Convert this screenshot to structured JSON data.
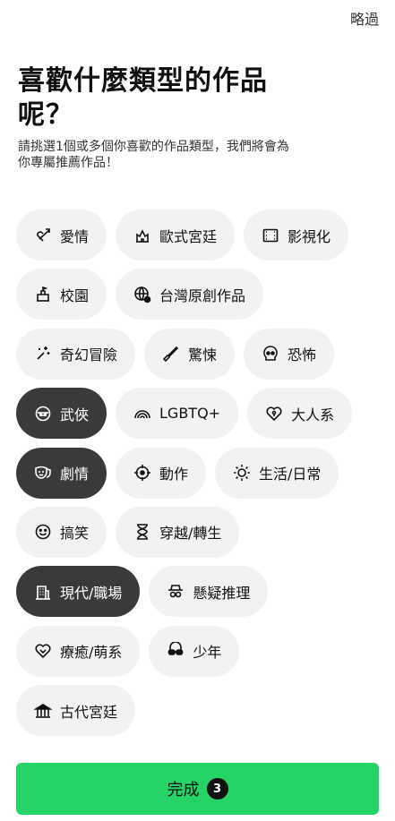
{
  "header": {
    "skip_label": "略過"
  },
  "title": "喜歡什麼類型的作品呢？",
  "description": "請挑選1個或多個你喜歡的作品類型，我們將會為你專屬推薦作品！",
  "genres": [
    {
      "label": "愛情",
      "icon": "cupid-arrow-icon",
      "selected": false
    },
    {
      "label": "歐式宮廷",
      "icon": "castle-icon",
      "selected": false
    },
    {
      "label": "影視化",
      "icon": "film-icon",
      "selected": false
    },
    {
      "label": "校園",
      "icon": "school-icon",
      "selected": false
    },
    {
      "label": "台灣原創作品",
      "icon": "globe-icon",
      "selected": false
    },
    {
      "label": "奇幻冒險",
      "icon": "magic-sparkle-icon",
      "selected": false
    },
    {
      "label": "驚悚",
      "icon": "knife-icon",
      "selected": false
    },
    {
      "label": "恐怖",
      "icon": "skull-icon",
      "selected": false
    },
    {
      "label": "武俠",
      "icon": "ninja-mask-icon",
      "selected": true
    },
    {
      "label": "LGBTQ+",
      "icon": "rainbow-icon",
      "selected": false
    },
    {
      "label": "大人系",
      "icon": "heart-lock-icon",
      "selected": false
    },
    {
      "label": "劇情",
      "icon": "theater-mask-icon",
      "selected": true
    },
    {
      "label": "動作",
      "icon": "crosshair-icon",
      "selected": false
    },
    {
      "label": "生活/日常",
      "icon": "sun-icon",
      "selected": false
    },
    {
      "label": "搞笑",
      "icon": "smile-icon",
      "selected": false
    },
    {
      "label": "穿越/轉生",
      "icon": "hourglass-icon",
      "selected": false
    },
    {
      "label": "現代/職場",
      "icon": "office-building-icon",
      "selected": true
    },
    {
      "label": "懸疑推理",
      "icon": "detective-icon",
      "selected": false
    },
    {
      "label": "療癒/萌系",
      "icon": "heart-outline-icon",
      "selected": false
    },
    {
      "label": "少年",
      "icon": "sunglasses-icon",
      "selected": false
    },
    {
      "label": "古代宮廷",
      "icon": "palace-icon",
      "selected": false
    }
  ],
  "footer": {
    "done_label": "完成",
    "selected_count": "3"
  },
  "colors": {
    "accent": "#25d366",
    "selected_chip": "#3a3a3a",
    "chip": "#f2f2f2"
  }
}
